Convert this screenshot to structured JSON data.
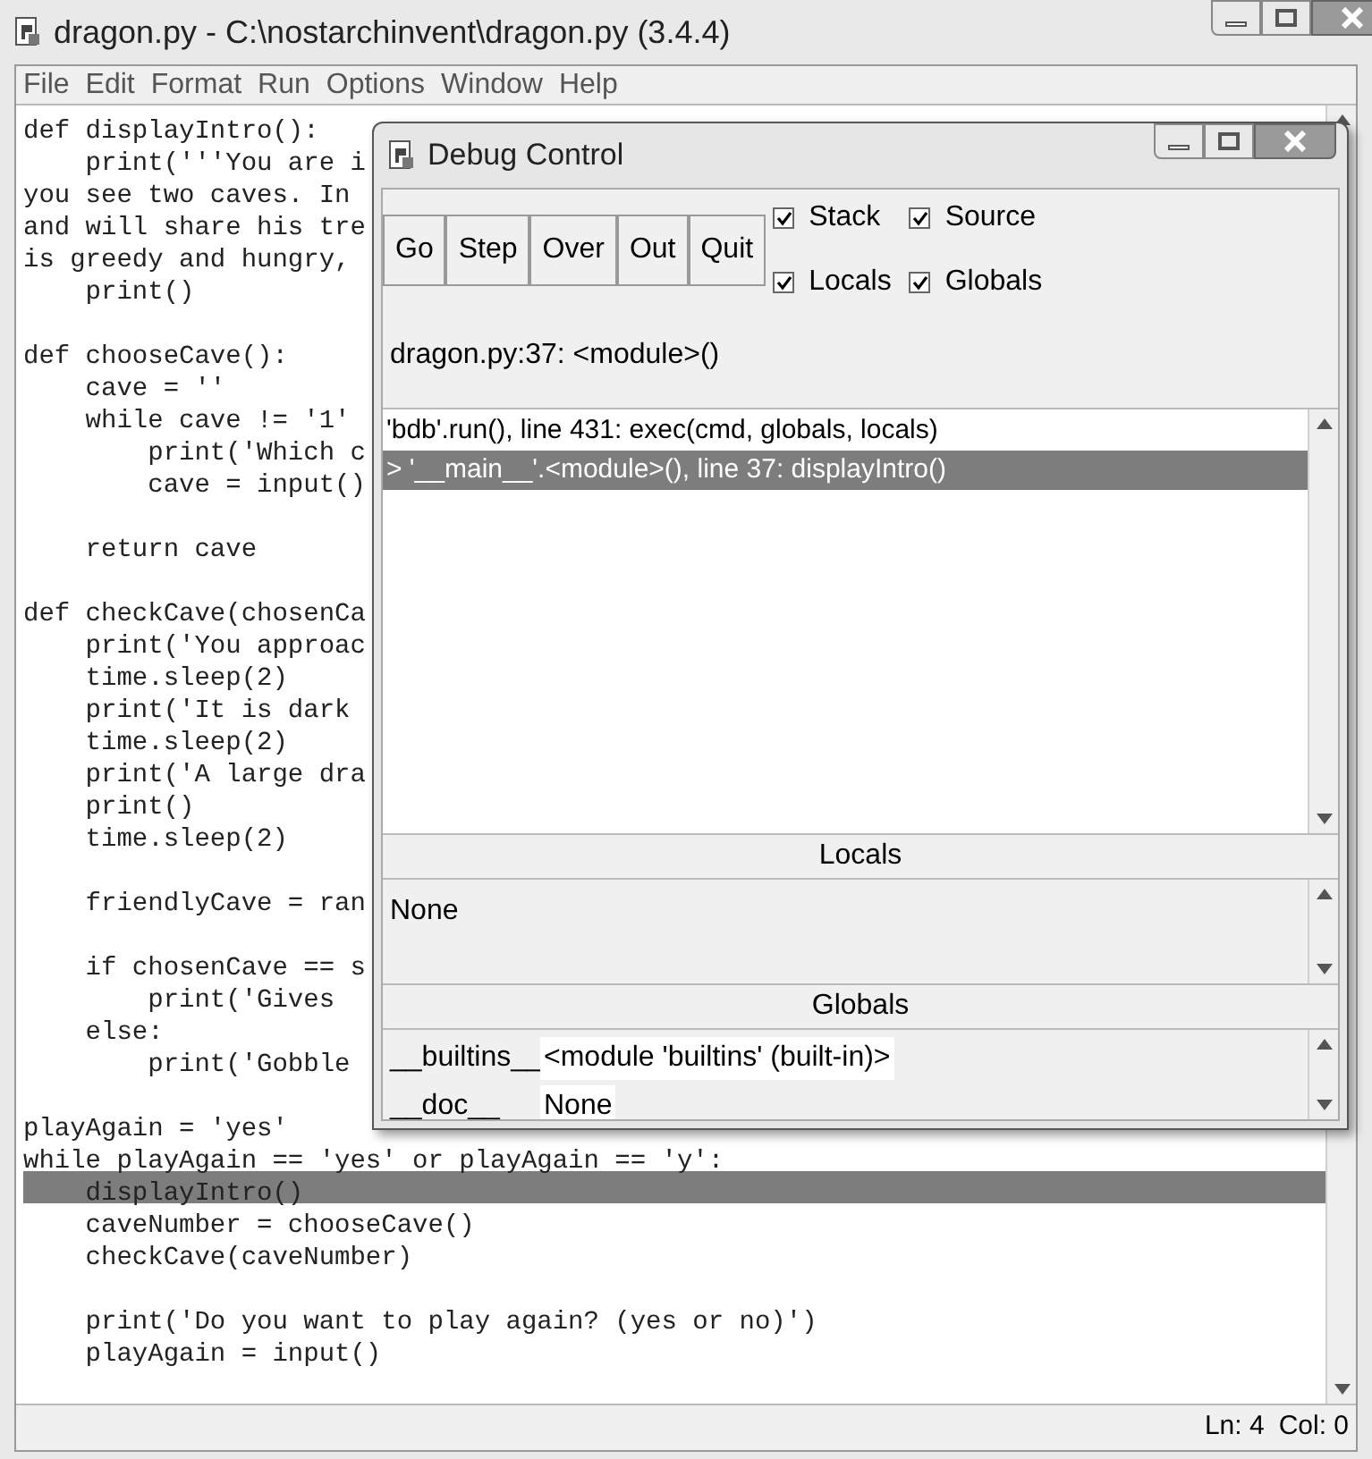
{
  "editor_window": {
    "title": "dragon.py - C:\\nostarchinvent\\dragon.py (3.4.4)",
    "menu": [
      "File",
      "Edit",
      "Format",
      "Run",
      "Options",
      "Window",
      "Help"
    ],
    "code_lines": [
      {
        "text": "def displayIntro():",
        "highlighted": false
      },
      {
        "text": "    print('''You are i",
        "highlighted": false
      },
      {
        "text": "you see two caves. In",
        "highlighted": false
      },
      {
        "text": "and will share his tre",
        "highlighted": false
      },
      {
        "text": "is greedy and hungry,",
        "highlighted": false
      },
      {
        "text": "    print()",
        "highlighted": false
      },
      {
        "highlighted": false
      },
      {
        "text": "def chooseCave():",
        "highlighted": false
      },
      {
        "text": "    cave = ''",
        "highlighted": false
      },
      {
        "text": "    while cave != '1'",
        "highlighted": false
      },
      {
        "text": "        print('Which c",
        "highlighted": false
      },
      {
        "text": "        cave = input()",
        "highlighted": false
      },
      {
        "highlighted": false
      },
      {
        "text": "    return cave",
        "highlighted": false
      },
      {
        "highlighted": false
      },
      {
        "text": "def checkCave(chosenCa",
        "highlighted": false
      },
      {
        "text": "    print('You approac",
        "highlighted": false
      },
      {
        "text": "    time.sleep(2)",
        "highlighted": false
      },
      {
        "text": "    print('It is dark",
        "highlighted": false
      },
      {
        "text": "    time.sleep(2)",
        "highlighted": false
      },
      {
        "text": "    print('A large dra",
        "highlighted": false
      },
      {
        "text": "    print()",
        "highlighted": false
      },
      {
        "text": "    time.sleep(2)",
        "highlighted": false
      },
      {
        "highlighted": false
      },
      {
        "text": "    friendlyCave = ran",
        "highlighted": false
      },
      {
        "highlighted": false
      },
      {
        "text": "    if chosenCave == s",
        "highlighted": false
      },
      {
        "text": "        print('Gives",
        "highlighted": false
      },
      {
        "text": "    else:",
        "highlighted": false
      },
      {
        "text": "        print('Gobble",
        "highlighted": false
      },
      {
        "highlighted": false
      },
      {
        "text": "playAgain = 'yes'",
        "highlighted": false
      },
      {
        "text": "while playAgain == 'yes' or playAgain == 'y':",
        "highlighted": false
      },
      {
        "text": "    displayIntro()",
        "highlighted": true
      },
      {
        "text": "    caveNumber = chooseCave()",
        "highlighted": false
      },
      {
        "text": "    checkCave(caveNumber)",
        "highlighted": false
      },
      {
        "highlighted": false
      },
      {
        "text": "    print('Do you want to play again? (yes or no)')",
        "highlighted": false
      },
      {
        "text": "    playAgain = input()",
        "highlighted": false
      }
    ],
    "status_bar": {
      "line": "Ln: 4",
      "column": "Col: 0"
    }
  },
  "debug_window": {
    "title": "Debug Control",
    "buttons": [
      "Go",
      "Step",
      "Over",
      "Out",
      "Quit"
    ],
    "checkboxes": [
      {
        "label": "Stack",
        "checked": true
      },
      {
        "label": "Source",
        "checked": true
      },
      {
        "label": "Locals",
        "checked": true
      },
      {
        "label": "Globals",
        "checked": true
      }
    ],
    "location": "dragon.py:37: <module>()",
    "stack": [
      {
        "text": "'bdb'.run(), line 431: exec(cmd, globals, locals)",
        "selected": false
      },
      {
        "text": "> '__main__'.<module>(), line 37: displayIntro()",
        "selected": true
      }
    ],
    "locals": {
      "header": "Locals",
      "text": "None"
    },
    "globals": {
      "header": "Globals",
      "rows": [
        {
          "name": "__builtins__",
          "value": "<module 'builtins' (built-in)>"
        },
        {
          "name": "__doc__",
          "value": "None"
        }
      ]
    }
  }
}
